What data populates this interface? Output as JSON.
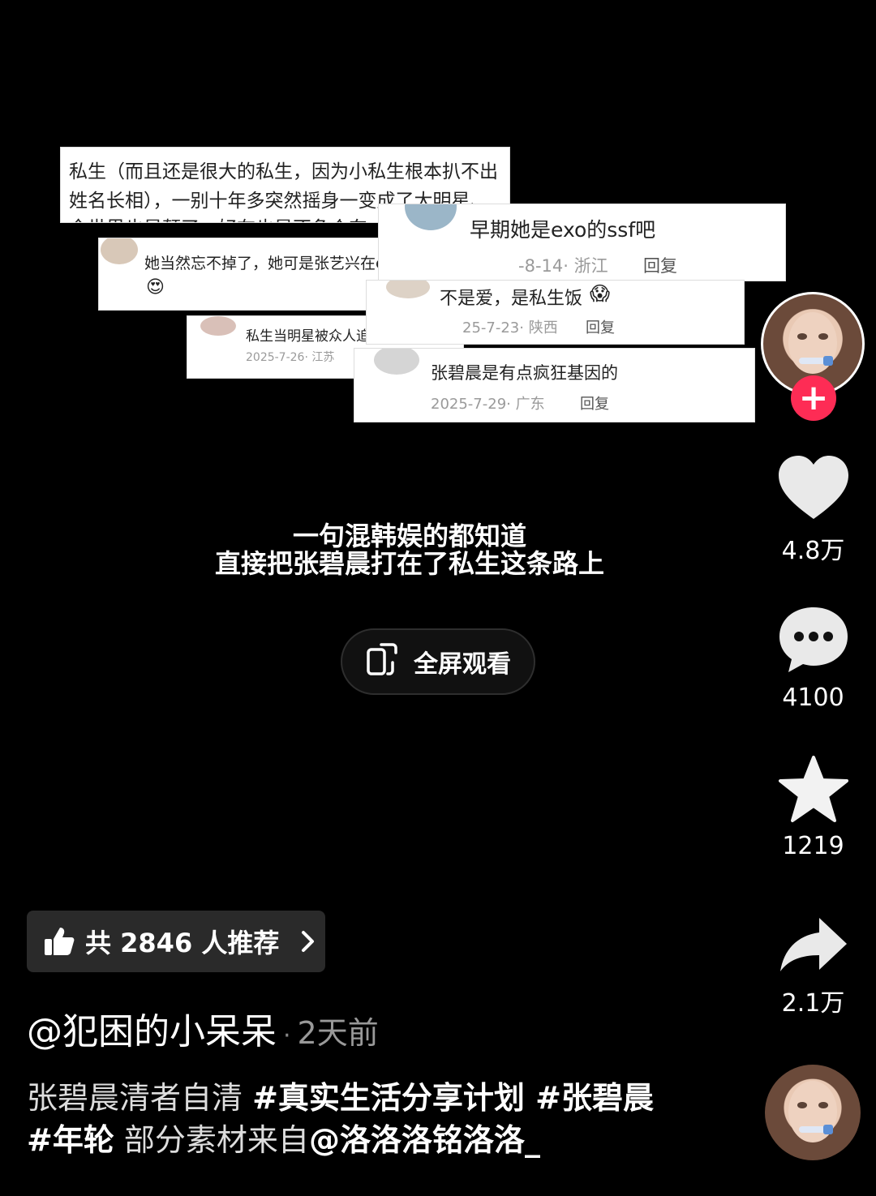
{
  "collage": {
    "card1": {
      "line1": "私生（而且还是很大的私生，因为小私生根本扒不出",
      "line2": "姓名长相），一别十年多突然摇身一变成了大明星、",
      "line3": "全世界也是颠了，好在也是不争个东"
    },
    "card2": {
      "text": "她当然忘不掉了，她可是张艺兴在exo 时的私生饭",
      "emoji": "😍"
    },
    "card3": {
      "text": "早期她是exo的ssf吧",
      "meta": "-8-14· 浙江",
      "reply": "回复"
    },
    "card4": {
      "text": "不是爱，是私生饭",
      "emoji": "😱",
      "meta": "25-7-23· 陕西",
      "reply": "回复"
    },
    "card5": {
      "text": "私生当明星被众人追捧",
      "meta": "2025-7-26· 江苏"
    },
    "card6": {
      "text": "张碧晨是有点疯狂基因的",
      "meta": "2025-7-29· 广东",
      "reply": "回复"
    }
  },
  "caption": {
    "line1": "一句混韩娱的都知道",
    "line2": "直接把张碧晨打在了私生这条路上"
  },
  "fullscreen_button": {
    "label": "全屏观看"
  },
  "rail": {
    "likes": "4.8万",
    "comments": "4100",
    "favorites": "1219",
    "shares": "2.1万",
    "follow_symbol": "+"
  },
  "recommend": {
    "label": "共 2846 人推荐"
  },
  "post": {
    "author": "@犯困的小呆呆",
    "separator": "·",
    "time": "2天前",
    "desc_plain1": "张碧晨清者自清 ",
    "tag1": "#真实生活分享计划",
    "tag2": " #张碧晨",
    "tag3": "#年轮",
    "desc_plain2": " 部分素材来自",
    "mention": "@洛洛洛铭洛洛_"
  },
  "icons": [
    "heart-icon",
    "comment-icon",
    "star-icon",
    "share-icon",
    "thumbs-up-icon",
    "chevron-right-icon",
    "fullscreen-icon"
  ],
  "colors": {
    "follow": "#fe2c55",
    "background": "#000000"
  }
}
